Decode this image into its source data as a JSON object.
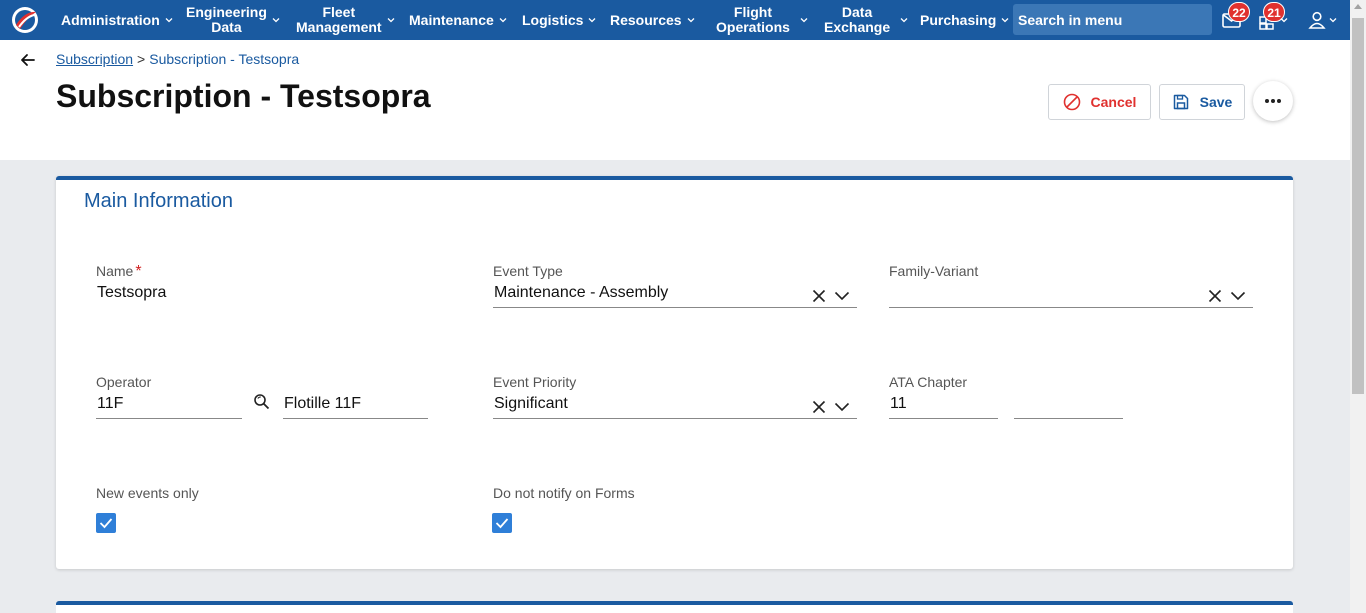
{
  "nav": {
    "items": [
      {
        "label": "Administration"
      },
      {
        "label": "Engineering\nData"
      },
      {
        "label": "Fleet\nManagement"
      },
      {
        "label": "Maintenance"
      },
      {
        "label": "Logistics"
      },
      {
        "label": "Resources"
      },
      {
        "label": "Flight\nOperations"
      },
      {
        "label": "Data\nExchange"
      },
      {
        "label": "Purchasing"
      }
    ],
    "search_placeholder": "Search in menu",
    "mail_badge": "22",
    "apps_badge": "21"
  },
  "breadcrumb": {
    "parent": "Subscription",
    "separator": ">",
    "current": "Subscription - Testsopra"
  },
  "page_title": "Subscription - Testsopra",
  "actions": {
    "cancel": "Cancel",
    "save": "Save"
  },
  "main_info": {
    "title": "Main Information",
    "name": {
      "label": "Name",
      "required": "*",
      "value": "Testsopra"
    },
    "event_type": {
      "label": "Event Type",
      "value": "Maintenance - Assembly"
    },
    "family_variant": {
      "label": "Family-Variant",
      "value": ""
    },
    "operator": {
      "label": "Operator",
      "code": "11F",
      "name": "Flotille 11F"
    },
    "event_priority": {
      "label": "Event Priority",
      "value": "Significant"
    },
    "ata_chapter": {
      "label": "ATA Chapter",
      "value": "11",
      "sub_value": ""
    },
    "new_events_only": {
      "label": "New events only",
      "checked": true
    },
    "do_not_notify": {
      "label": "Do not notify on Forms",
      "checked": true
    }
  },
  "colors": {
    "primary": "#1a5aa0",
    "danger": "#e0312f",
    "checkbox": "#2f7fd8"
  }
}
